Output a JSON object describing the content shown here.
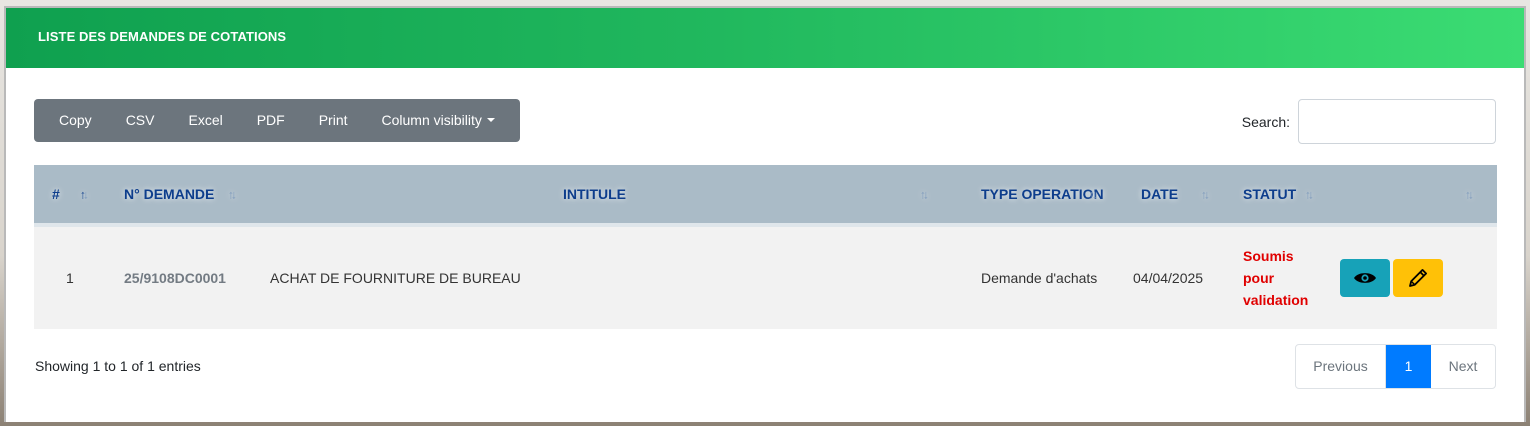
{
  "header": {
    "title": "LISTE DES DEMANDES DE COTATIONS"
  },
  "toolbar": {
    "buttons": [
      "Copy",
      "CSV",
      "Excel",
      "PDF",
      "Print",
      "Column visibility"
    ]
  },
  "search": {
    "label": "Search:",
    "value": ""
  },
  "table": {
    "columns": [
      "#",
      "N° DEMANDE",
      "INTITULE",
      "TYPE OPERATION",
      "DATE",
      "STATUT",
      ""
    ],
    "rows": [
      {
        "index": "1",
        "numero": "25/9108DC0001",
        "intitule": "ACHAT DE FOURNITURE DE BUREAU",
        "type_operation": "Demande d'achats",
        "date": "04/04/2025",
        "statut_lines": [
          "Soumis",
          "pour",
          "validation"
        ]
      }
    ]
  },
  "footer": {
    "info": "Showing 1 to 1 of 1 entries",
    "pagination": {
      "previous": "Previous",
      "current": "1",
      "next": "Next"
    }
  },
  "colors": {
    "header_start": "#0fa04f",
    "header_end": "#3bdc73",
    "status": "#e00000",
    "view_button": "#17a2b8",
    "edit_button": "#ffc107",
    "page_active": "#007bff"
  }
}
